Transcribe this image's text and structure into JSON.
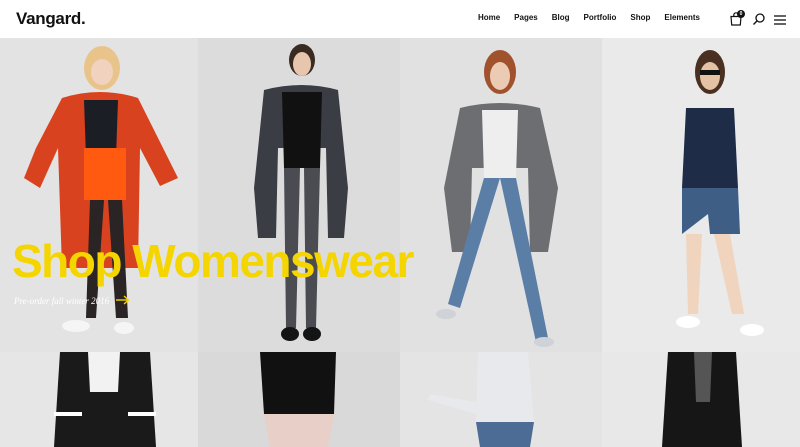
{
  "brand": {
    "name": "Vangard."
  },
  "nav": {
    "items": [
      {
        "label": "Home"
      },
      {
        "label": "Pages"
      },
      {
        "label": "Blog"
      },
      {
        "label": "Portfolio"
      },
      {
        "label": "Shop"
      },
      {
        "label": "Elements"
      }
    ]
  },
  "cart": {
    "count": "0",
    "icon": "shopping-bag-icon"
  },
  "icons": {
    "search": "search-icon",
    "menu": "hamburger-menu-icon",
    "arrow": "arrow-right-icon"
  },
  "hero": {
    "title": "Shop Womenswear",
    "subtitle": "Pre-order fall winter 2016"
  },
  "colors": {
    "accent": "#f5d500",
    "text": "#111111"
  },
  "products": [
    {
      "name": "red-parka-orange-skirt",
      "bg": "#e3e3e3"
    },
    {
      "name": "black-camo-jacket",
      "bg": "#dcdcdc"
    },
    {
      "name": "grey-cardigan-jeans",
      "bg": "#e1e1e1"
    },
    {
      "name": "patterned-top-denim-shorts",
      "bg": "#eaeaea"
    },
    {
      "name": "bomber-jacket",
      "bg": "#e6e6e6"
    },
    {
      "name": "black-top-light-pants",
      "bg": "#d9d9d9"
    },
    {
      "name": "slogan-sweatshirt",
      "bg": "#e4e4e4"
    },
    {
      "name": "quilted-jacket",
      "bg": "#e8e8e8"
    }
  ]
}
